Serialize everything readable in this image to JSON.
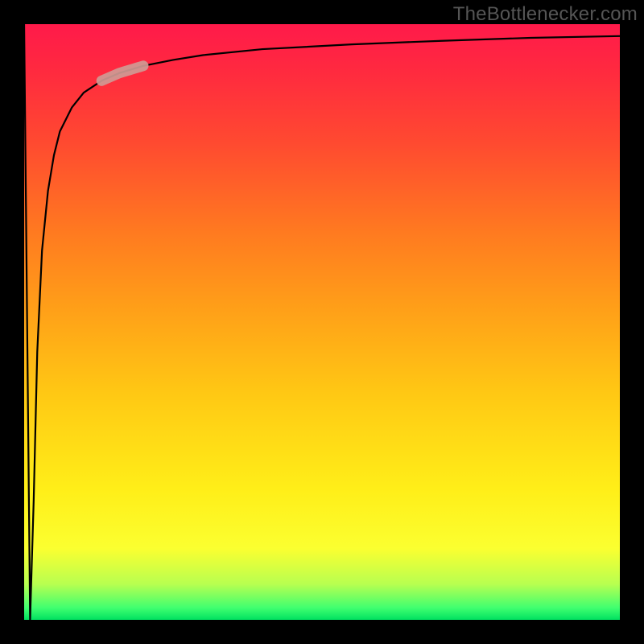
{
  "watermark": "TheBottlenecker.com",
  "colors": {
    "frame": "#000000",
    "curve_main": "#000000",
    "curve_highlight": "#cf9a94"
  },
  "chart_data": {
    "type": "line",
    "title": "",
    "xlabel": "",
    "ylabel": "",
    "xlim": [
      0,
      100
    ],
    "ylim": [
      0,
      100
    ],
    "grid": false,
    "series": [
      {
        "name": "bottleneck-curve",
        "x": [
          0,
          1,
          1.6,
          2.2,
          3,
          4,
          5,
          6,
          8,
          10,
          13,
          16,
          20,
          25,
          30,
          40,
          55,
          70,
          85,
          100
        ],
        "y": [
          100,
          0,
          20,
          45,
          62,
          72,
          78,
          82,
          86,
          88.5,
          90.5,
          91.8,
          93,
          94,
          94.8,
          95.8,
          96.6,
          97.2,
          97.7,
          98
        ]
      }
    ],
    "annotations": [
      {
        "name": "highlight-segment",
        "x_range": [
          13,
          20
        ],
        "y_range": [
          90.2,
          93
        ],
        "style": "thick-stroke"
      }
    ],
    "background_gradient": {
      "orientation": "vertical",
      "stops": [
        {
          "pos": 0.0,
          "color": "#ff1a4a"
        },
        {
          "pos": 0.2,
          "color": "#ff4a30"
        },
        {
          "pos": 0.45,
          "color": "#ffa018"
        },
        {
          "pos": 0.75,
          "color": "#ffee18"
        },
        {
          "pos": 0.95,
          "color": "#60ff60"
        },
        {
          "pos": 1.0,
          "color": "#00e060"
        }
      ]
    }
  }
}
